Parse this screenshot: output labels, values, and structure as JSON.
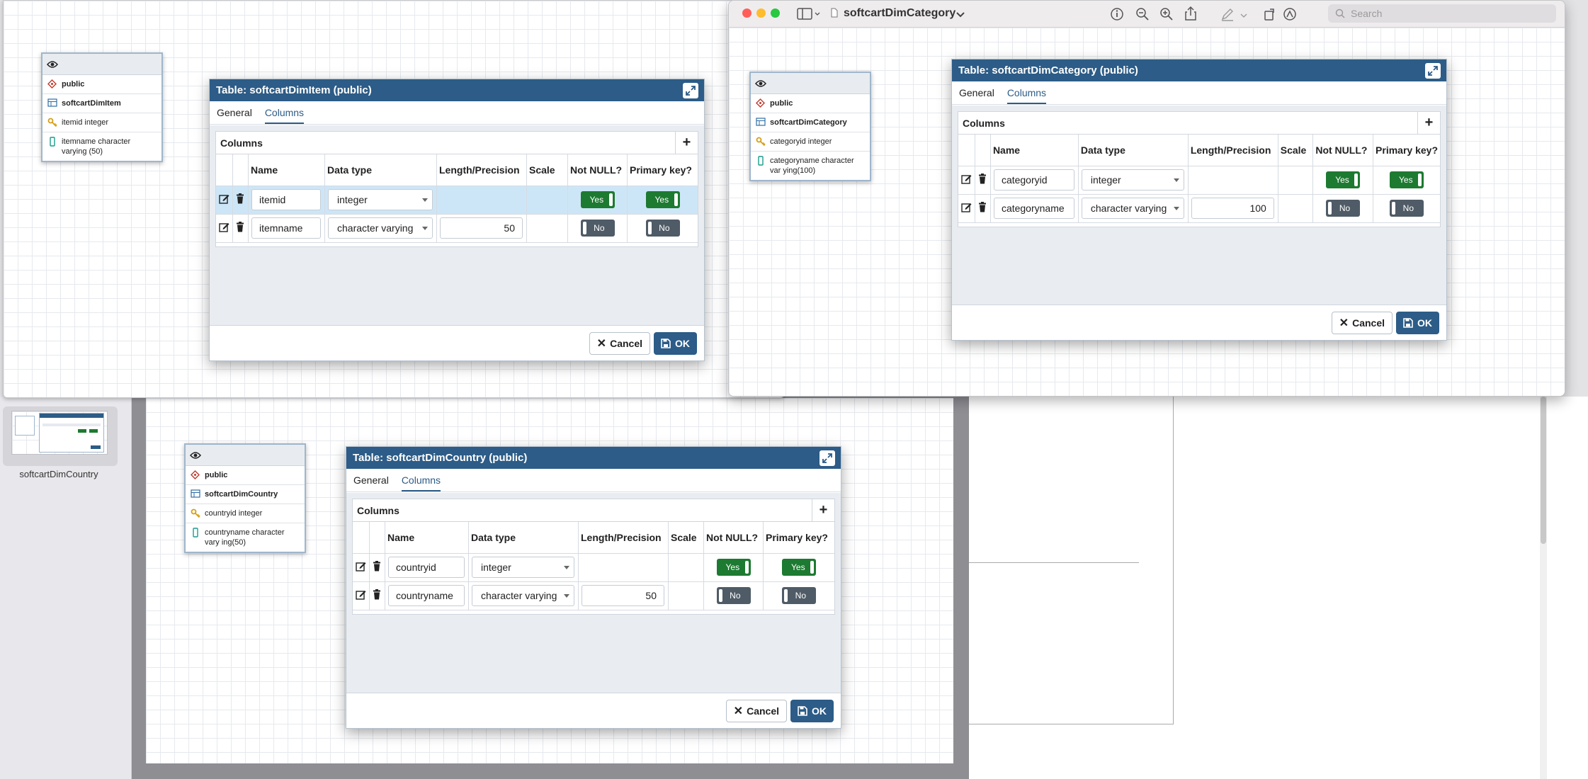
{
  "window": {
    "title": "softcartDimCategory",
    "search_placeholder": "Search"
  },
  "thumbnail": {
    "label": "softcartDimCountry"
  },
  "nodes": [
    {
      "schema": "public",
      "table": "softcartDimItem",
      "pk_col": "itemid integer",
      "col2": "itemname character varying (50)"
    },
    {
      "schema": "public",
      "table": "softcartDimCategory",
      "pk_col": "categoryid integer",
      "col2": "categoryname character var ying(100)"
    },
    {
      "schema": "public",
      "table": "softcartDimCountry",
      "pk_col": "countryid integer",
      "col2": "countryname character vary ing(50)"
    }
  ],
  "dialogs": [
    {
      "title": "Table: softcartDimItem (public)",
      "tabs": [
        "General",
        "Columns"
      ],
      "panel_title": "Columns",
      "headers": [
        "Name",
        "Data type",
        "Length/Precision",
        "Scale",
        "Not NULL?",
        "Primary key?"
      ],
      "rows": [
        {
          "name": "itemid",
          "type": "integer",
          "length": "",
          "notnull": "Yes",
          "pk": "Yes"
        },
        {
          "name": "itemname",
          "type": "character varying",
          "length": "50",
          "notnull": "No",
          "pk": "No"
        }
      ],
      "cancel": "Cancel",
      "ok": "OK"
    },
    {
      "title": "Table: softcartDimCategory (public)",
      "tabs": [
        "General",
        "Columns"
      ],
      "panel_title": "Columns",
      "headers": [
        "Name",
        "Data type",
        "Length/Precision",
        "Scale",
        "Not NULL?",
        "Primary key?"
      ],
      "rows": [
        {
          "name": "categoryid",
          "type": "integer",
          "length": "",
          "notnull": "Yes",
          "pk": "Yes"
        },
        {
          "name": "categoryname",
          "type": "character varying",
          "length": "100",
          "notnull": "No",
          "pk": "No"
        }
      ],
      "cancel": "Cancel",
      "ok": "OK"
    },
    {
      "title": "Table: softcartDimCountry (public)",
      "tabs": [
        "General",
        "Columns"
      ],
      "panel_title": "Columns",
      "headers": [
        "Name",
        "Data type",
        "Length/Precision",
        "Scale",
        "Not NULL?",
        "Primary key?"
      ],
      "rows": [
        {
          "name": "countryid",
          "type": "integer",
          "length": "",
          "notnull": "Yes",
          "pk": "Yes"
        },
        {
          "name": "countryname",
          "type": "character varying",
          "length": "50",
          "notnull": "No",
          "pk": "No"
        }
      ],
      "cancel": "Cancel",
      "ok": "OK"
    }
  ]
}
